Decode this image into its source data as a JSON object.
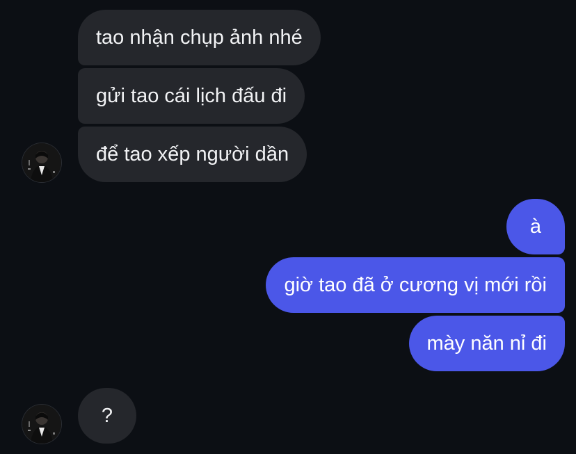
{
  "messages": [
    {
      "from": "them",
      "text": "tao nhận chụp ảnh nhé"
    },
    {
      "from": "them",
      "text": "gửi tao cái lịch đấu đi"
    },
    {
      "from": "them",
      "text": "để tao xếp người dần"
    },
    {
      "from": "me",
      "text": "à"
    },
    {
      "from": "me",
      "text": "giờ tao đã ở cương vị mới rồi"
    },
    {
      "from": "me",
      "text": "mày năn nỉ đi"
    },
    {
      "from": "them",
      "text": "?"
    }
  ],
  "colors": {
    "background": "#0c0f14",
    "incoming_bubble": "#25272c",
    "outgoing_bubble": "#4b57e8",
    "text": "#f2f3f5"
  },
  "icons": {
    "contact_avatar": "person-photo-avatar"
  }
}
